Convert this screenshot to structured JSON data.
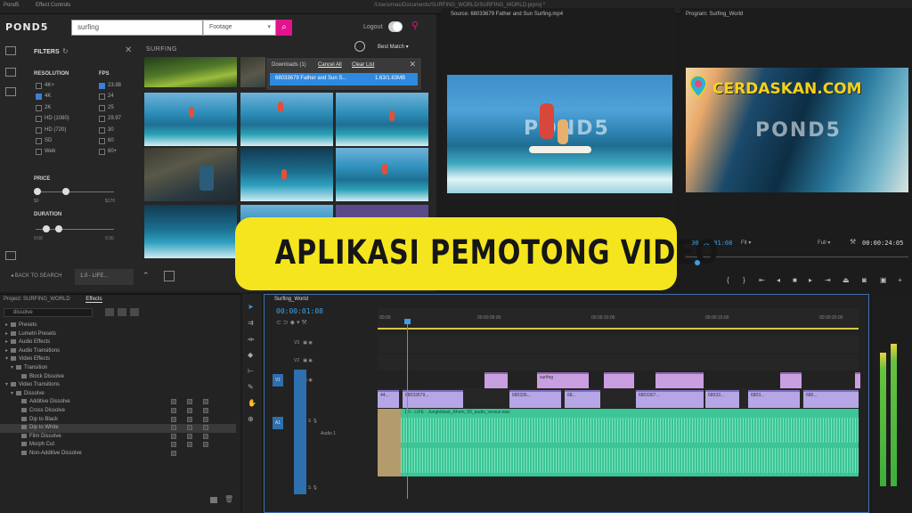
{
  "window": {
    "path": "/Users/mac/Documents/SURFING_WORLD/SURFING_WORLD.prproj *"
  },
  "pond5": {
    "tabs": [
      "Pond5",
      "Effect Controls"
    ],
    "logo": "POND5",
    "search_value": "surfing",
    "category": "Footage",
    "logout": "Logout",
    "filters_title": "FILTERS",
    "resolution_title": "RESOLUTION",
    "resolution_options": [
      "4K+",
      "4K",
      "2K",
      "HD (1080)",
      "HD (720)",
      "SD",
      "Web"
    ],
    "fps_title": "FPS",
    "fps_options": [
      "23.98",
      "24",
      "25",
      "29.97",
      "30",
      "60",
      "60+"
    ],
    "price_title": "PRICE",
    "price_min": "$0",
    "price_max": "$170",
    "duration_title": "DURATION",
    "duration_min": "0:00",
    "duration_max": "0:30",
    "results_title": "SURFING",
    "sort": "Best Match",
    "downloads": {
      "header": "Downloads (1)",
      "cancel_all": "Cancel All",
      "clear_list": "Clear List",
      "item_name": "68033679 Father and Sun S...",
      "item_progress": "1.63/1.63MB"
    },
    "back_to_search": "BACK TO SEARCH",
    "tray_label": "1.0 - LIFE..."
  },
  "source": {
    "title": "Source: 68033679 Father and Sun Surfing.mp4",
    "watermark": "POND5"
  },
  "program": {
    "title": "Program: Surfing_World",
    "watermark": "POND5",
    "timecode_in": "00:00:01:08",
    "fit": "Fit",
    "quality": "Full",
    "timecode_out": "00:00:24:05"
  },
  "overlay": {
    "brand": "CERDASKAN.COM",
    "title": "APLIKASI PEMOTONG VIDEO"
  },
  "effects": {
    "tabs": [
      "Project: SURFING_WORLD",
      "Effects"
    ],
    "search_value": "dissolve",
    "items": [
      {
        "label": "Presets",
        "level": 0,
        "type": "folder"
      },
      {
        "label": "Lumetri Presets",
        "level": 0,
        "type": "folder"
      },
      {
        "label": "Audio Effects",
        "level": 0,
        "type": "folder"
      },
      {
        "label": "Audio Transitions",
        "level": 0,
        "type": "folder"
      },
      {
        "label": "Video Effects",
        "level": 0,
        "type": "folder"
      },
      {
        "label": "Transition",
        "level": 1,
        "type": "folder"
      },
      {
        "label": "Block Dissolve",
        "level": 2,
        "type": "fx"
      },
      {
        "label": "Video Transitions",
        "level": 0,
        "type": "folder"
      },
      {
        "label": "Dissolve",
        "level": 1,
        "type": "folder"
      },
      {
        "label": "Additive Dissolve",
        "level": 2,
        "type": "fx"
      },
      {
        "label": "Cross Dissolve",
        "level": 2,
        "type": "fx"
      },
      {
        "label": "Dip to Black",
        "level": 2,
        "type": "fx"
      },
      {
        "label": "Dip to White",
        "level": 2,
        "type": "fx"
      },
      {
        "label": "Film Dissolve",
        "level": 2,
        "type": "fx"
      },
      {
        "label": "Morph Cut",
        "level": 2,
        "type": "fx"
      },
      {
        "label": "Non-Additive Dissolve",
        "level": 2,
        "type": "fx"
      }
    ]
  },
  "timeline": {
    "tab": "Surfing_World",
    "timecode": "00:00:01:08",
    "ruler": [
      "00:00",
      "00:00:05:00",
      "00:00:10:00",
      "00:00:15:00",
      "00:00:20:00"
    ],
    "tracks": [
      "V3",
      "V2",
      "V1",
      "A1",
      "A2"
    ],
    "audio_track_name": "Audio 1",
    "audio_clip_label": "1.0 - LIFE - Jungleblast_Ahem_60_audio_versus.wav",
    "v2_label": "surfing",
    "v1_labels": [
      "44...",
      "68033679...",
      "680336...",
      "68...",
      "6803367...",
      "68033...",
      "6803...",
      "680..."
    ],
    "track_label_v1": "V1",
    "track_label_a1": "A1"
  },
  "colors": {
    "banner": "#f5e51e",
    "brand": "#f3d21b",
    "pond5_accent": "#e2138c",
    "timecode": "#3ea0e8",
    "audio_clip": "#3cc596",
    "video_clip": "#b6a6e6"
  }
}
